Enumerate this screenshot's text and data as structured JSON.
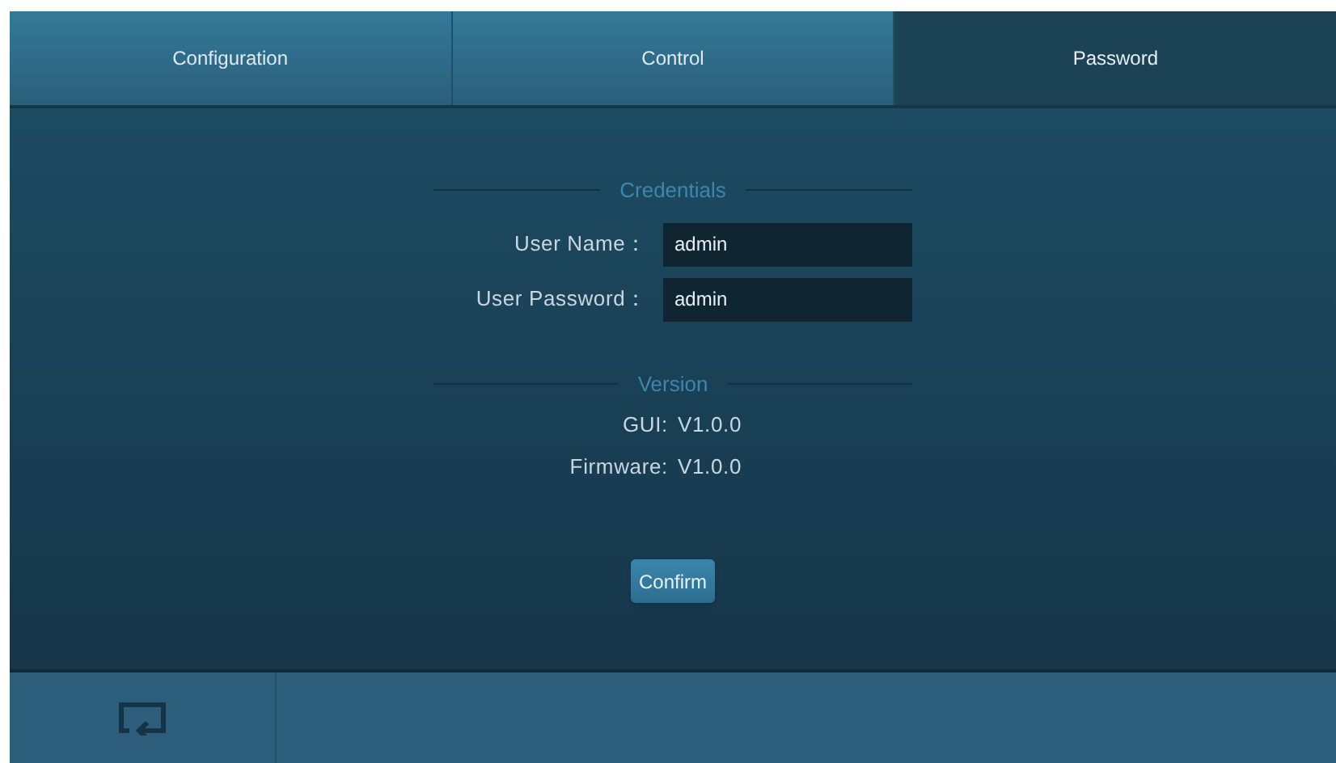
{
  "tabs": [
    {
      "label": "Configuration",
      "selected": false
    },
    {
      "label": "Control",
      "selected": false
    },
    {
      "label": "Password",
      "selected": true
    }
  ],
  "credentials": {
    "title": "Credentials",
    "fields": [
      {
        "label": "User Name：",
        "value": "admin"
      },
      {
        "label": "User Password：",
        "value": "admin"
      }
    ]
  },
  "version": {
    "title": "Version",
    "rows": [
      {
        "label": "GUI:",
        "value": "V1.0.0"
      },
      {
        "label": "Firmware:",
        "value": "V1.0.0"
      }
    ]
  },
  "confirm_button": "Confirm"
}
